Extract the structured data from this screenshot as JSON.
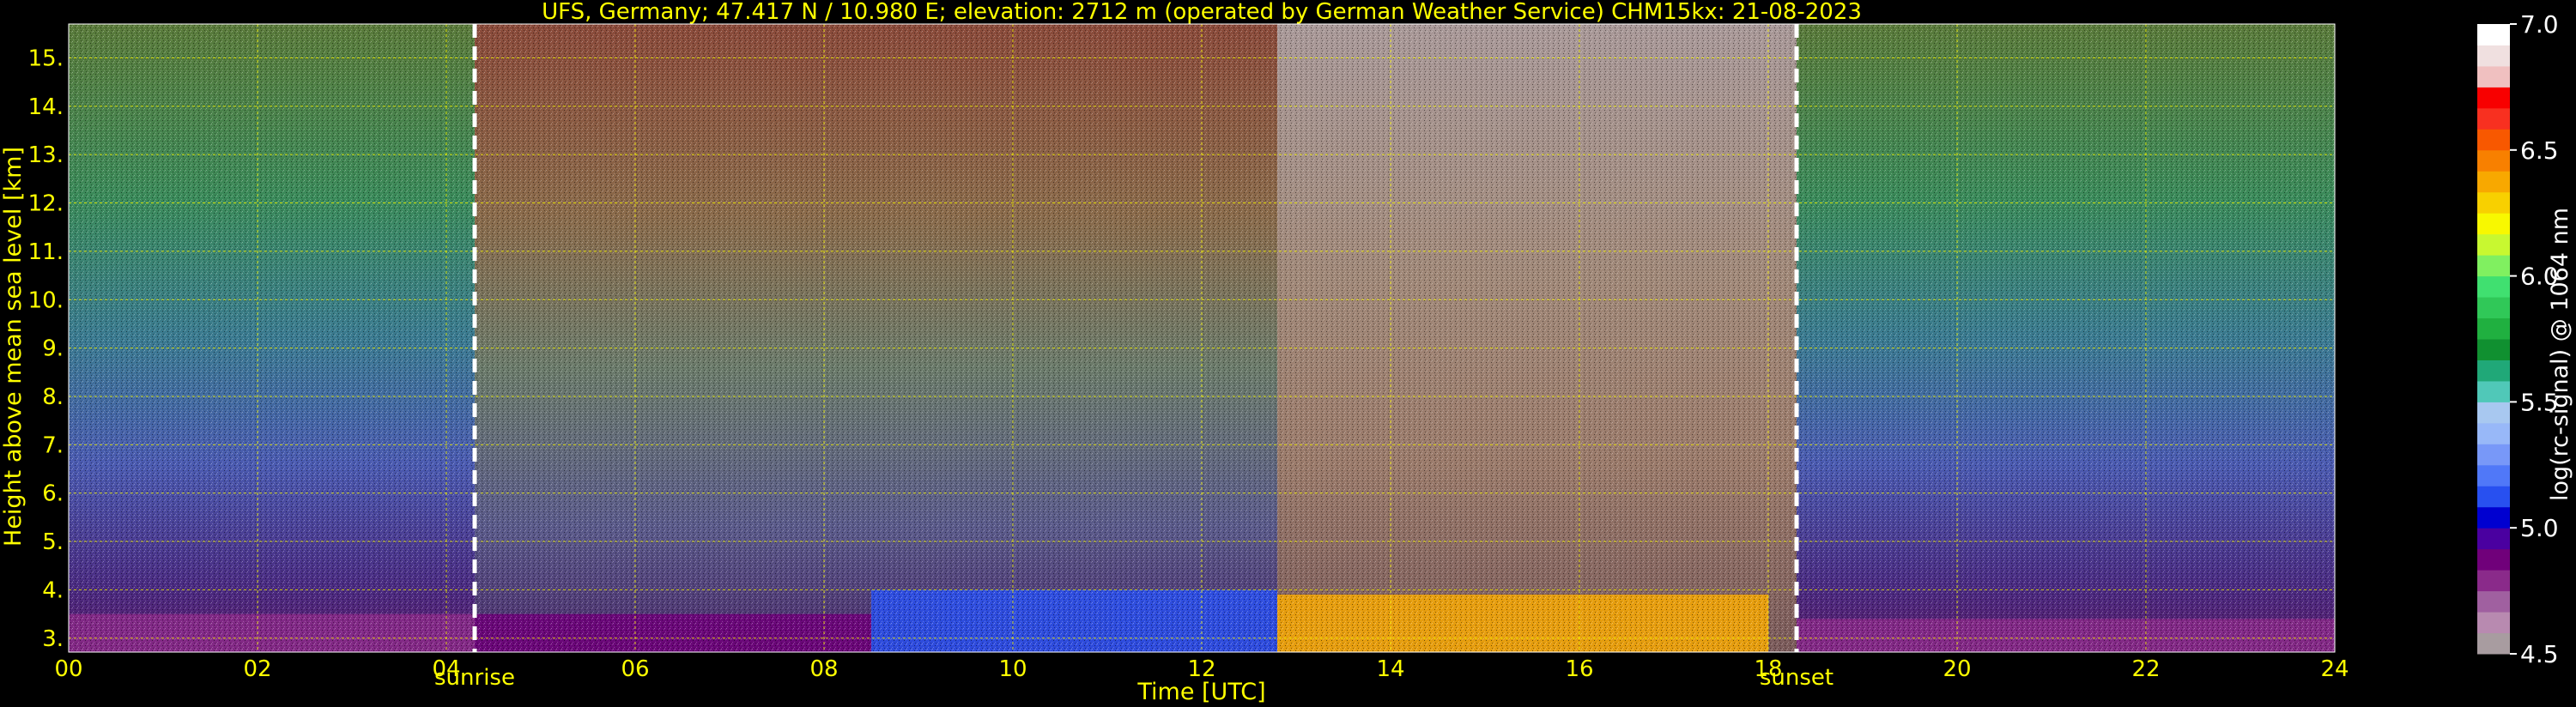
{
  "chart_data": {
    "type": "heatmap",
    "title": "UFS, Germany; 47.417 N / 10.980 E; elevation: 2712 m  (operated by German Weather Service)    CHM15kx: 21-08-2023",
    "xlabel": "Time [UTC]",
    "ylabel": "Height above mean sea level [km]",
    "xlim": [
      0,
      24
    ],
    "ylim": [
      2.712,
      15.7
    ],
    "x_ticks": [
      {
        "value": 0,
        "label": "00"
      },
      {
        "value": 2,
        "label": "02"
      },
      {
        "value": 4,
        "label": "04"
      },
      {
        "value": 6,
        "label": "06"
      },
      {
        "value": 8,
        "label": "08"
      },
      {
        "value": 10,
        "label": "10"
      },
      {
        "value": 12,
        "label": "12"
      },
      {
        "value": 14,
        "label": "14"
      },
      {
        "value": 16,
        "label": "16"
      },
      {
        "value": 18,
        "label": "18"
      },
      {
        "value": 20,
        "label": "20"
      },
      {
        "value": 22,
        "label": "22"
      },
      {
        "value": 24,
        "label": "24"
      }
    ],
    "y_ticks": [
      {
        "value": 3,
        "label": "3."
      },
      {
        "value": 4,
        "label": "4."
      },
      {
        "value": 5,
        "label": "5."
      },
      {
        "value": 6,
        "label": "6."
      },
      {
        "value": 7,
        "label": "7."
      },
      {
        "value": 8,
        "label": "8."
      },
      {
        "value": 9,
        "label": "9."
      },
      {
        "value": 10,
        "label": "10."
      },
      {
        "value": 11,
        "label": "11."
      },
      {
        "value": 12,
        "label": "12."
      },
      {
        "value": 13,
        "label": "13."
      },
      {
        "value": 14,
        "label": "14."
      },
      {
        "value": 15,
        "label": "15."
      }
    ],
    "grid": true,
    "grid_color": "#ffff00",
    "annotations": [
      {
        "label": "sunrise",
        "time": 4.3
      },
      {
        "label": "sunset",
        "time": 18.3
      }
    ],
    "colorbar": {
      "label": "log(rc-signal) @ 1064 nm",
      "range": [
        4.5,
        7.0
      ],
      "ticks": [
        {
          "value": 4.5,
          "label": "4.5"
        },
        {
          "value": 5.0,
          "label": "5.0"
        },
        {
          "value": 5.5,
          "label": "5.5"
        },
        {
          "value": 6.0,
          "label": "6.0"
        },
        {
          "value": 6.5,
          "label": "6.5"
        },
        {
          "value": 7.0,
          "label": "7.0"
        }
      ],
      "colors": [
        "#a89ca0",
        "#b88ab0",
        "#a060a0",
        "#8a2a8a",
        "#70007a",
        "#4a00a0",
        "#0000d0",
        "#2850f0",
        "#5078f8",
        "#7898f8",
        "#98b8f8",
        "#a8c8f0",
        "#50c8b8",
        "#20a878",
        "#109030",
        "#20b040",
        "#30c858",
        "#40e070",
        "#80f060",
        "#c8f830",
        "#f8f800",
        "#f8d000",
        "#f8a800",
        "#f88000",
        "#f85800",
        "#f83020",
        "#f80000",
        "#f0c0c0",
        "#f0e0e0",
        "#ffffff"
      ]
    },
    "layers": [
      {
        "time_start": 0,
        "time_end": 4.3,
        "top_km": 3.5,
        "value": 4.8
      },
      {
        "time_start": 4.3,
        "time_end": 8.5,
        "top_km": 3.5,
        "value": 4.9
      },
      {
        "time_start": 8.5,
        "time_end": 12.8,
        "top_km": 4.0,
        "value": 5.1
      },
      {
        "time_start": 12.8,
        "time_end": 18.0,
        "top_km": 3.9,
        "value": 6.4
      },
      {
        "time_start": 18.3,
        "time_end": 24,
        "top_km": 3.4,
        "value": 4.8
      }
    ]
  }
}
